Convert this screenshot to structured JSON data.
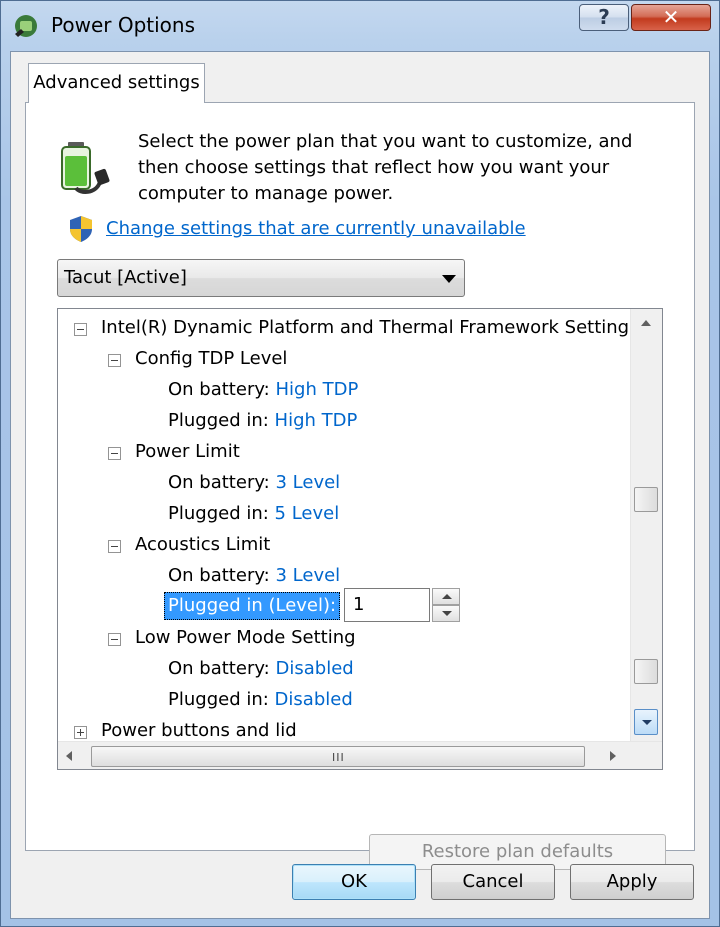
{
  "window": {
    "title": "Power Options",
    "help_label": "?",
    "close_label": "✕"
  },
  "tab": {
    "label": "Advanced settings"
  },
  "description": "Select the power plan that you want to customize, and then choose settings that reflect how you want your computer to manage power.",
  "link": {
    "label": "Change settings that are currently unavailable"
  },
  "plan_select": {
    "value": "Tacut [Active]"
  },
  "tree": {
    "root_label": "Intel(R) Dynamic Platform and Thermal Framework Setting",
    "config_tdp": {
      "label": "Config TDP Level",
      "battery_label": "On battery:",
      "battery_value": "High TDP",
      "plugged_label": "Plugged in:",
      "plugged_value": "High TDP"
    },
    "power_limit": {
      "label": "Power Limit",
      "battery_label": "On battery:",
      "battery_value": "3 Level",
      "plugged_label": "Plugged in:",
      "plugged_value": "5 Level"
    },
    "acoustics_limit": {
      "label": "Acoustics Limit",
      "battery_label": "On battery:",
      "battery_value": "3 Level",
      "plugged_label": "Plugged in (Level):",
      "plugged_value": "1"
    },
    "low_power": {
      "label": "Low Power Mode Setting",
      "battery_label": "On battery:",
      "battery_value": "Disabled",
      "plugged_label": "Plugged in:",
      "plugged_value": "Disabled"
    },
    "power_buttons_label": "Power buttons and lid",
    "hscroll_grip": "III"
  },
  "restore_label": "Restore plan defaults",
  "buttons": {
    "ok": "OK",
    "cancel": "Cancel",
    "apply": "Apply"
  }
}
